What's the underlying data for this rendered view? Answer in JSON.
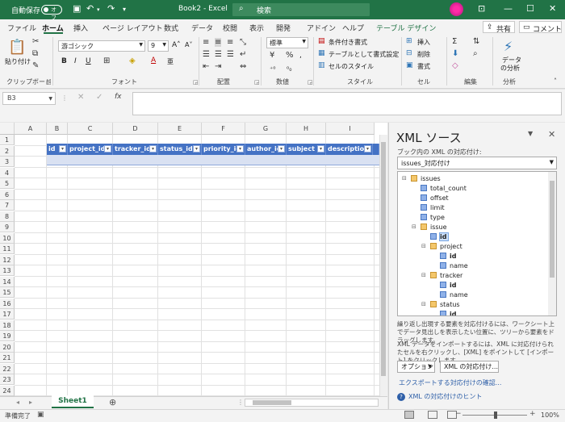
{
  "titlebar": {
    "autosave_label": "自動保存",
    "autosave_state": "オフ",
    "doc_title": "Book2 - Excel",
    "search_placeholder": "検索"
  },
  "tabs": [
    "ファイル",
    "ホーム",
    "挿入",
    "ページ レイアウト",
    "数式",
    "データ",
    "校閲",
    "表示",
    "開発",
    "アドイン",
    "ヘルプ",
    "テーブル デザイン"
  ],
  "share_label": "共有",
  "comment_label": "コメント",
  "ribbon": {
    "clipboard": {
      "paste": "貼り付け",
      "group": "クリップボード"
    },
    "font": {
      "name": "游ゴシック",
      "size": "9",
      "group": "フォント"
    },
    "alignment": {
      "group": "配置"
    },
    "number": {
      "format": "標準",
      "group": "数値"
    },
    "styles": {
      "conditional": "条件付き書式",
      "as_table": "テーブルとして書式設定",
      "cell_styles": "セルのスタイル",
      "group": "スタイル"
    },
    "cells": {
      "insert": "挿入",
      "delete": "削除",
      "format": "書式",
      "group": "セル"
    },
    "editing": {
      "group": "編集"
    },
    "analysis": {
      "label1": "データ",
      "label2": "の分析",
      "group": "分析"
    }
  },
  "formula_bar": {
    "name_box": "B3",
    "fx": "fx",
    "formula": ""
  },
  "grid": {
    "columns": [
      "A",
      "B",
      "C",
      "D",
      "E",
      "F",
      "G",
      "H",
      "I"
    ],
    "rows": [
      "1",
      "2",
      "3",
      "4",
      "5",
      "6",
      "7",
      "8",
      "9",
      "10",
      "11",
      "12",
      "13",
      "14",
      "15",
      "16",
      "17",
      "18",
      "19",
      "20",
      "21",
      "22",
      "23",
      "24"
    ],
    "table_headers": [
      "id",
      "project_id",
      "tracker_id",
      "status_id",
      "priority_id",
      "author_id",
      "subject",
      "description"
    ]
  },
  "sheet_tab": "Sheet1",
  "xml_pane": {
    "title": "XML ソース",
    "maps_label": "ブック内の XML の対応付け:",
    "selected_map": "issues_対応付け",
    "tree": {
      "root": "issues",
      "total_count": "total_count",
      "offset": "offset",
      "limit": "limit",
      "type": "type",
      "issue": "issue",
      "issue_id": "id",
      "project": "project",
      "project_id": "id",
      "project_name": "name",
      "tracker": "tracker",
      "tracker_id": "id",
      "tracker_name": "name",
      "status": "status",
      "status_id": "id"
    },
    "help1": "繰り返し出現する要素を対応付けるには、ワークシート上でデータ見出しを表示したい位置に、ツリーから要素をドラッグします。",
    "help2": "XML データをインポートするには、XML に対応付けられたセルを右クリックし、[XML] をポイントして [インポート] をクリックします。",
    "options_button": "オプション",
    "map_button": "XML の対応付け...",
    "verify_link": "エクスポートする対応付けの確認...",
    "tip_link": "XML の対応付けのヒント"
  },
  "status": {
    "text": "準備完了",
    "zoom": "100%"
  }
}
